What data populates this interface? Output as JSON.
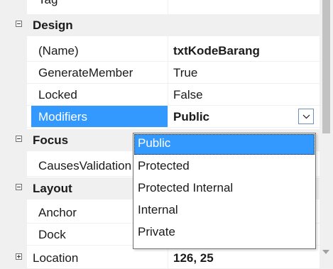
{
  "property_grid": {
    "clipped_top_label": "Tag",
    "categories": {
      "design": "Design",
      "focus": "Focus",
      "layout": "Layout"
    },
    "properties": {
      "name": {
        "label": "(Name)",
        "value": "txtKodeBarang"
      },
      "generate_member": {
        "label": "GenerateMember",
        "value": "True"
      },
      "locked": {
        "label": "Locked",
        "value": "False"
      },
      "modifiers": {
        "label": "Modifiers",
        "value": "Public"
      },
      "causes_validation": {
        "label": "CausesValidation",
        "value": ""
      },
      "anchor": {
        "label": "Anchor",
        "value": ""
      },
      "dock": {
        "label": "Dock",
        "value": ""
      },
      "location": {
        "label": "Location",
        "value": "126, 25"
      }
    },
    "selected_property": "Modifiers"
  },
  "modifiers_dropdown": {
    "options": [
      "Public",
      "Protected",
      "Protected Internal",
      "Internal",
      "Private"
    ],
    "selected": "Public"
  },
  "colors": {
    "selection": "#3399ff",
    "gutter": "#f0f0f0",
    "text": "#1a1a1a"
  }
}
